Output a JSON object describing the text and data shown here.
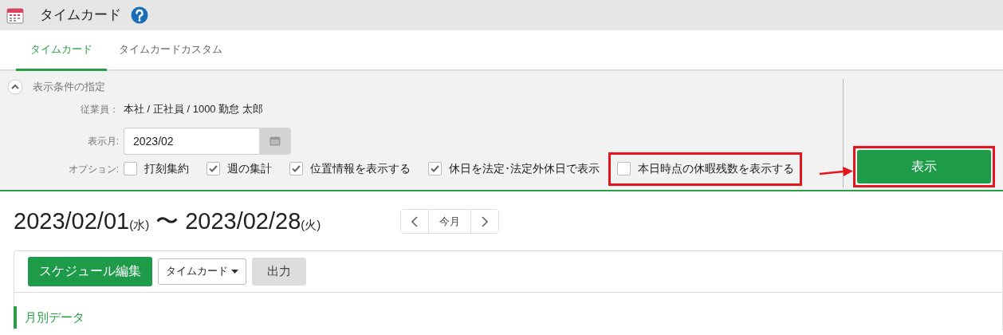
{
  "header": {
    "title": "タイムカード"
  },
  "tabs": [
    {
      "label": "タイムカード",
      "selected": true
    },
    {
      "label": "タイムカードカスタム",
      "selected": false
    }
  ],
  "conditions": {
    "title": "表示条件の指定",
    "expanded": true,
    "employee_label": "従業員：",
    "employee_value": "本社 / 正社員 / 1000 勤怠 太郎",
    "month_label": "表示月:",
    "month_value": "2023/02",
    "options_label": "オプション:",
    "options": [
      {
        "label": "打刻集約",
        "checked": false,
        "highlighted": false
      },
      {
        "label": "週の集計",
        "checked": true,
        "highlighted": false
      },
      {
        "label": "位置情報を表示する",
        "checked": true,
        "highlighted": false
      },
      {
        "label": "休日を法定･法定外休日で表示",
        "checked": true,
        "highlighted": false
      },
      {
        "label": "本日時点の休暇残数を表示する",
        "checked": false,
        "highlighted": true
      }
    ],
    "show_button": {
      "label": "表示",
      "highlighted": true
    }
  },
  "range": {
    "start": "2023/02/01",
    "start_day": "(水)",
    "separator": "〜",
    "end": "2023/02/28",
    "end_day": "(火)"
  },
  "month_nav": {
    "today": "今月"
  },
  "toolbar": {
    "edit_button": "スケジュール編集",
    "view_select": "タイムカード",
    "export_button": "出力"
  },
  "section_title": "月別データ"
}
